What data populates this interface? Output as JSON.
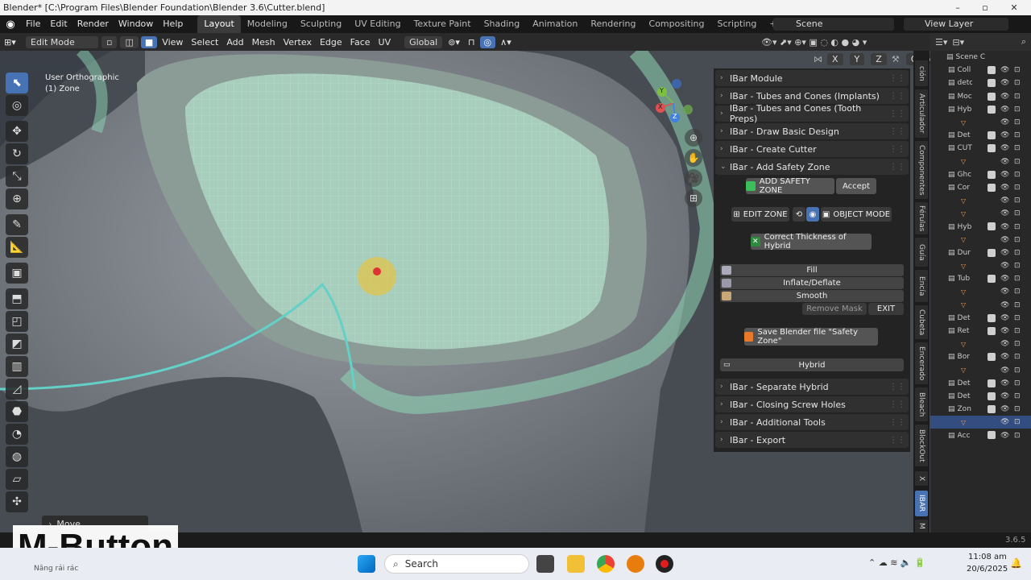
{
  "window": {
    "title": "Blender* [C:\\Program Files\\Blender Foundation\\Blender 3.6\\Cutter.blend]",
    "minimize": "–",
    "maximize": "▫",
    "close": "✕"
  },
  "menu": {
    "items": [
      "File",
      "Edit",
      "Render",
      "Window",
      "Help"
    ]
  },
  "workspaces": [
    "Layout",
    "Modeling",
    "Sculpting",
    "UV Editing",
    "Texture Paint",
    "Shading",
    "Animation",
    "Rendering",
    "Compositing",
    "Scripting"
  ],
  "workspace_add": "+",
  "scene": {
    "label": "Scene",
    "view_layer": "View Layer"
  },
  "header": {
    "mode": "Edit Mode",
    "view": "View",
    "select": "Select",
    "add": "Add",
    "mesh": "Mesh",
    "vertex": "Vertex",
    "edge": "Edge",
    "face": "Face",
    "uv": "UV",
    "transform": "Global",
    "axes": [
      "X",
      "Y",
      "Z"
    ],
    "options": "Options"
  },
  "viewport": {
    "line1": "User Orthographic",
    "line2": "(1) Zone"
  },
  "gizmo": {
    "x": "X",
    "y": "Y",
    "z": "Z"
  },
  "panel": {
    "top_items": [
      "IBar Module",
      "IBar - Tubes and Cones (Implants)",
      "IBar - Tubes and Cones (Tooth Preps)",
      "IBar - Draw Basic Design",
      "IBar - Create Cutter"
    ],
    "open_item": "IBar - Add Safety Zone",
    "add_safety_zone": "ADD SAFETY ZONE",
    "accept": "Accept",
    "edit_zone": "EDIT ZONE",
    "object_mode": "OBJECT MODE",
    "correct_thickness": "Correct Thickness of Hybrid",
    "fill": "Fill",
    "inflate": "Inflate/Deflate",
    "smooth": "Smooth",
    "remove_mask": "Remove Mask",
    "exit": "EXIT",
    "save_file": "Save Blender file \"Safety Zone\"",
    "hybrid": "Hybrid",
    "bottom_items": [
      "IBar - Separate Hybrid",
      "IBar - Closing Screw Holes",
      "IBar - Additional Tools",
      "IBar - Export"
    ]
  },
  "vtabs": [
    "ción",
    "Articulador",
    "Componentes",
    "Férulas",
    "Guía",
    "Encía",
    "Cubeta",
    "Encerado",
    "Bleach",
    "BlockOut",
    "X",
    "IBAR",
    "M"
  ],
  "outliner": {
    "scene_collection": "Scene C",
    "rows": [
      "Coll",
      "deto",
      "Moc",
      "Hyb",
      "",
      "Det",
      "CUT",
      "",
      "Ghc",
      "Cor",
      "",
      "",
      "Hyb",
      "",
      "Dur",
      "",
      "Tub",
      "",
      "",
      "Det",
      "Ret",
      "",
      "Bor",
      "",
      "Det",
      "Det",
      "Zon",
      "",
      "Acc"
    ]
  },
  "move_panel": "Move",
  "caption": "M-Button",
  "statusbar": {
    "version": "3.6.5",
    "left_text": "Năng rải rác"
  },
  "taskbar": {
    "search": "Search",
    "time": "11:08 am",
    "date": "20/6/2025"
  },
  "icons": {
    "blender": "blender-logo-icon",
    "search": "magnifier-icon"
  }
}
